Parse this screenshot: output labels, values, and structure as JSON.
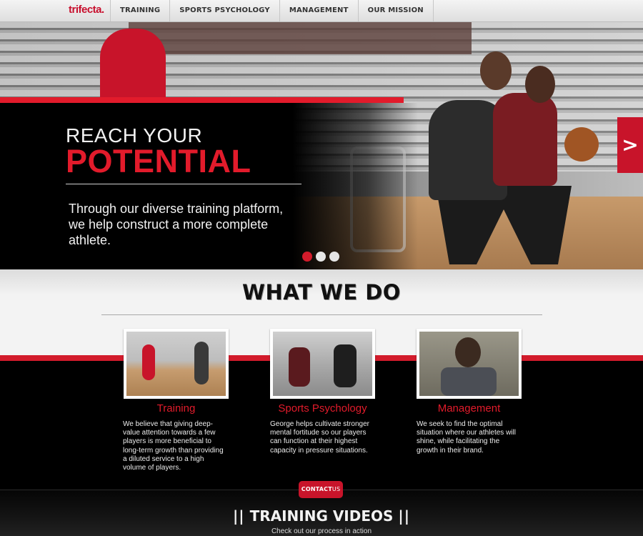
{
  "nav": {
    "logo": "trifecta.",
    "items": [
      {
        "label": "TRAINING"
      },
      {
        "label": "SPORTS PSYCHOLOGY"
      },
      {
        "label": "MANAGEMENT"
      },
      {
        "label": "OUR MISSION"
      }
    ]
  },
  "hero": {
    "kicker": "REACH YOUR",
    "headline": "POTENTIAL",
    "description": "Through our diverse training platform, we help construct a more complete athlete.",
    "next_arrow": ">",
    "slides": 3,
    "active_slide": 1,
    "accent_color": "#e21b2b"
  },
  "what_we_do": {
    "title": "WHAT WE DO",
    "cards": [
      {
        "title": "Training",
        "description": "We believe that giving deep-value attention towards a few players is more beneficial to long-term growth than providing a diluted service to a high volume of players."
      },
      {
        "title": "Sports Psychology",
        "description": "George helps cultivate stronger mental fortitude so our players can function at their highest capacity in pressure situations."
      },
      {
        "title": "Management",
        "description": "We seek to find the optimal situation where our athletes will shine, while facilitating the growth in their brand."
      }
    ]
  },
  "contact": {
    "label_bold": "CONTACT",
    "label_rest": "US"
  },
  "training_videos": {
    "title": "TRAINING VIDEOS",
    "bars": "||",
    "subtitle": "Check out our process in action"
  }
}
